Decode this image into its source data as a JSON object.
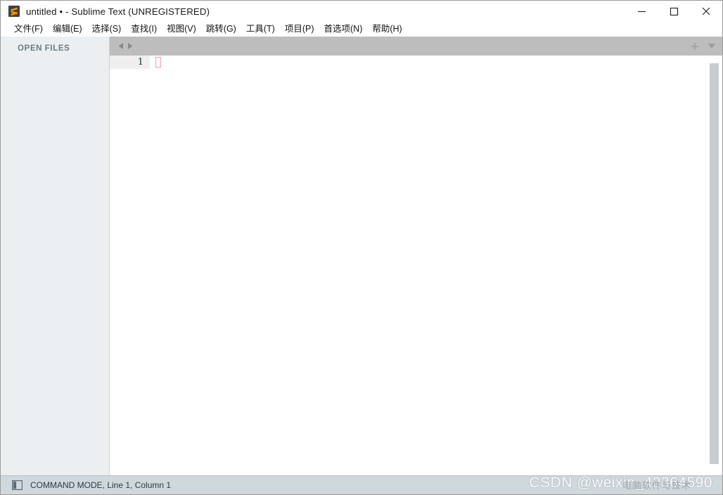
{
  "window": {
    "title": "untitled • - Sublime Text (UNREGISTERED)",
    "app_icon_name": "sublime-text-logo",
    "controls": {
      "minimize_label": "Minimize",
      "maximize_label": "Maximize",
      "close_label": "Close"
    }
  },
  "menubar": {
    "items": [
      {
        "label": "文件(F)"
      },
      {
        "label": "编辑(E)"
      },
      {
        "label": "选择(S)"
      },
      {
        "label": "查找(I)"
      },
      {
        "label": "视图(V)"
      },
      {
        "label": "跳转(G)"
      },
      {
        "label": "工具(T)"
      },
      {
        "label": "项目(P)"
      },
      {
        "label": "首选项(N)"
      },
      {
        "label": "帮助(H)"
      }
    ]
  },
  "sidebar": {
    "heading": "OPEN FILES",
    "items": []
  },
  "tabbar": {
    "prev_label": "Previous tab",
    "next_label": "Next tab",
    "new_tab_label": "+",
    "tab_menu_label": "Tab list"
  },
  "editor": {
    "lines": [
      {
        "number": "1",
        "text": ""
      }
    ],
    "cursor": {
      "line": 1,
      "column": 1,
      "style": "block-outline",
      "color": "#f19cc0"
    }
  },
  "statusbar": {
    "sidebar_toggle_name": "sidebar-toggle-icon",
    "text": "COMMAND MODE, Line 1, Column 1"
  },
  "watermark": {
    "main": "CSDN @weixin_42364590",
    "sub": "电脑软件与技术"
  },
  "colors": {
    "titlebar_bg": "#ffffff",
    "menubar_bg": "#ffffff",
    "sidebar_bg": "#eceff1",
    "tabbar_bg": "#bdbdbd",
    "editor_bg": "#ffffff",
    "gutter_line_bg": "#efefef",
    "statusbar_bg": "#cfd8dc",
    "cursor": "#f19cc0",
    "accent": "#ff9800"
  }
}
